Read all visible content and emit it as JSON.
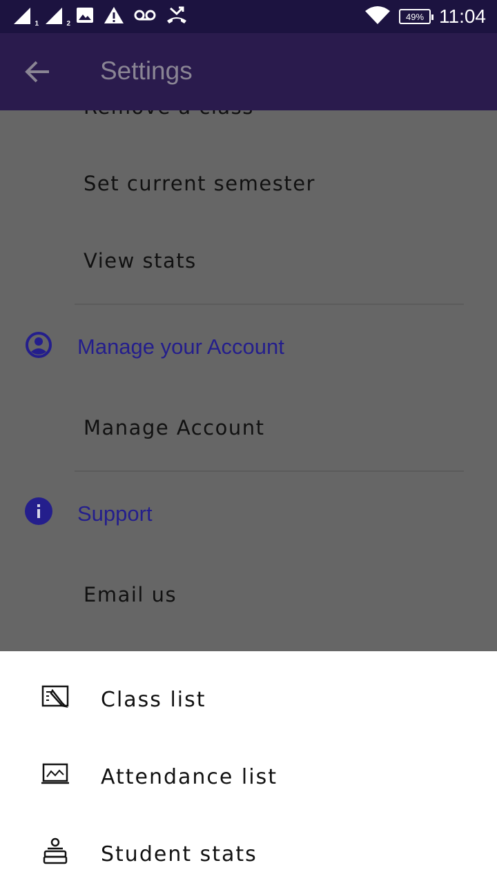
{
  "status_bar": {
    "time": "11:04",
    "battery": "49%",
    "sim1_label": "1",
    "sim2_label": "2",
    "icons": [
      "signal-icon",
      "signal-icon",
      "image-icon",
      "alert-icon",
      "voicemail-icon",
      "missed-call-icon",
      "wifi-icon",
      "battery-icon"
    ]
  },
  "app_bar": {
    "title": "Settings",
    "back_icon": "arrow-back-icon"
  },
  "settings": {
    "partial_item": "Remove a class",
    "items_top": [
      "Set current semester",
      "View stats"
    ],
    "account_section": {
      "title": "Manage your Account",
      "icon": "account-circle-icon",
      "items": [
        "Manage Account"
      ]
    },
    "support_section": {
      "title": "Support",
      "icon": "info-icon",
      "items": [
        "Email us"
      ]
    }
  },
  "bottom_sheet": {
    "items": [
      {
        "label": "Class list",
        "icon": "class-list-icon"
      },
      {
        "label": "Attendance list",
        "icon": "attendance-list-icon"
      },
      {
        "label": "Student stats",
        "icon": "student-stats-icon"
      }
    ]
  },
  "colors": {
    "status_bar": "#1c1340",
    "app_bar": "#2a1b4d",
    "scrim": "#666666",
    "accent": "#241e8c"
  }
}
